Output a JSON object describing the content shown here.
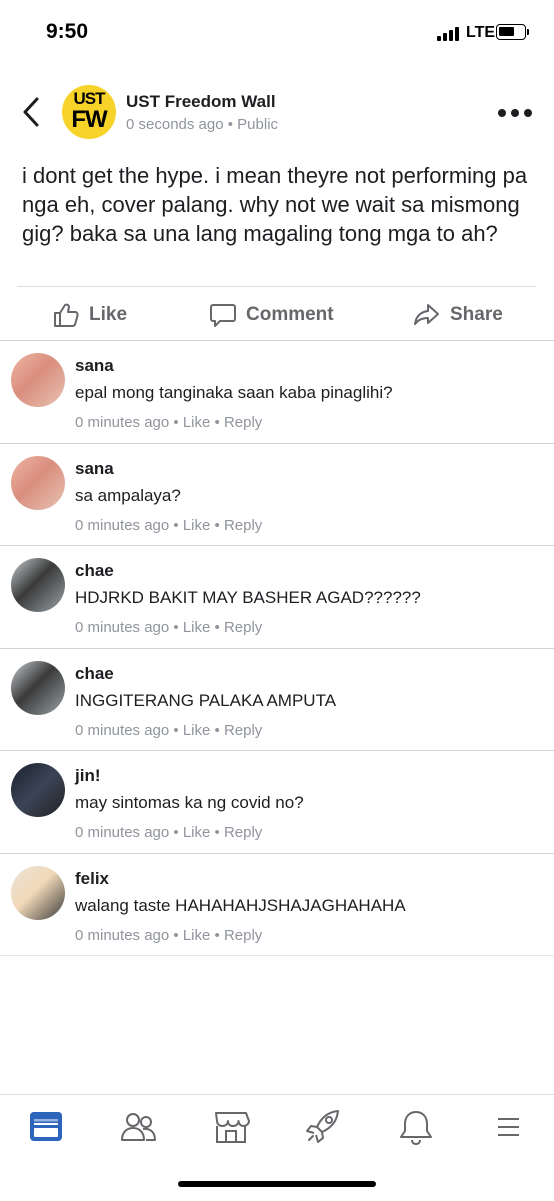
{
  "status_bar": {
    "time": "9:50",
    "network": "LTE"
  },
  "post": {
    "page_name": "UST Freedom Wall",
    "avatar_line1": "UST",
    "avatar_line2": "FW",
    "timestamp": "0 seconds ago",
    "separator": " • ",
    "privacy": "Public",
    "body": "i dont get the hype. i mean theyre not performing pa nga eh, cover palang. why not we wait sa mismong gig? baka sa una lang magaling tong mga to ah?"
  },
  "actions": {
    "like": "Like",
    "comment": "Comment",
    "share": "Share"
  },
  "comments": [
    {
      "author": "sana",
      "text": "epal mong tanginaka saan kaba pinaglihi?",
      "time": "0 minutes ago",
      "like": "Like",
      "reply": "Reply",
      "sep": " • "
    },
    {
      "author": "sana",
      "text": "sa ampalaya?",
      "time": "0 minutes ago",
      "like": "Like",
      "reply": "Reply",
      "sep": " • "
    },
    {
      "author": "chae",
      "text": "HDJRKD BAKIT MAY BASHER AGAD??????",
      "time": "0 minutes ago",
      "like": "Like",
      "reply": "Reply",
      "sep": " • "
    },
    {
      "author": "chae",
      "text": "INGGITERANG PALAKA AMPUTA",
      "time": "0 minutes ago",
      "like": "Like",
      "reply": "Reply",
      "sep": " • "
    },
    {
      "author": "jin!",
      "text": "may sintomas ka ng covid no?",
      "time": "0 minutes ago",
      "like": "Like",
      "reply": "Reply",
      "sep": " • "
    },
    {
      "author": "felix",
      "text": "walang taste HAHAHAHJSHAJAGHAHAHA",
      "time": "0 minutes ago",
      "like": "Like",
      "reply": "Reply",
      "sep": " • "
    }
  ],
  "bottom_nav": [
    "news-feed-icon",
    "friends-icon",
    "marketplace-icon",
    "rocket-icon",
    "bell-icon",
    "menu-icon"
  ],
  "colors": {
    "accent": "#2d64bc",
    "avatar_yellow": "#f7d32a",
    "muted_text": "#90949c",
    "action_text": "#65676b"
  }
}
